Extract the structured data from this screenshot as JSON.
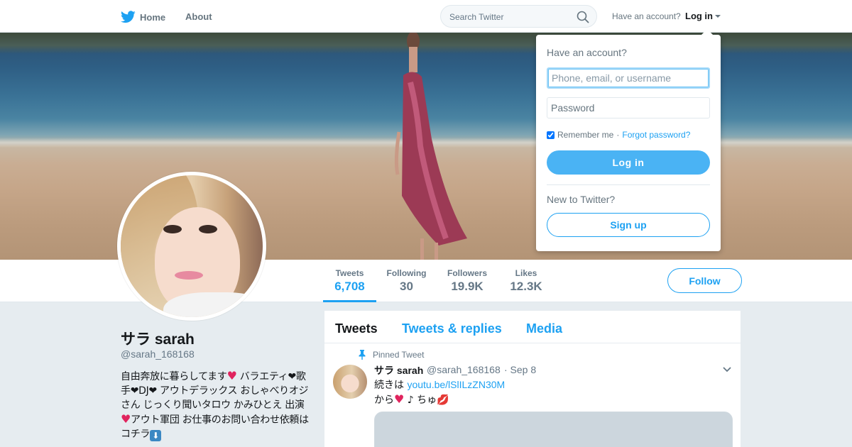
{
  "nav": {
    "home_label": "Home",
    "about_label": "About",
    "search_placeholder": "Search Twitter",
    "have_account": "Have an account?",
    "login_label": "Log in"
  },
  "profile": {
    "name": "サラ sarah",
    "handle": "@sarah_168168",
    "bio": {
      "part1": "自由奔放に暮らしてます",
      "part2": " バラエティ",
      "part3": "❤歌手❤DJ❤ アウトデラックス おしゃべりオジさん じっくり聞いタロウ かみひとえ 出演",
      "part4": "アウト軍団 お仕事のお問い合わせ依頼はコチラ",
      "heart": "♥",
      "arrow": "⬇"
    }
  },
  "stats": [
    {
      "label": "Tweets",
      "value": "6,708"
    },
    {
      "label": "Following",
      "value": "30"
    },
    {
      "label": "Followers",
      "value": "19.9K"
    },
    {
      "label": "Likes",
      "value": "12.3K"
    }
  ],
  "follow_label": "Follow",
  "timeline": {
    "tabs": [
      "Tweets",
      "Tweets & replies",
      "Media"
    ],
    "pinned_label": "Pinned Tweet",
    "tweet": {
      "name": "サラ sarah",
      "handle": "@sarah_168168",
      "date": "· Sep 8",
      "line1_prefix": "続きは ",
      "link": "youtu.be/lSlILzZN30M",
      "line2_prefix": "から",
      "line2_suffix": " ♪ ちゅ",
      "lips": "💋"
    }
  },
  "login_dropdown": {
    "title": "Have an account?",
    "username_placeholder": "Phone, email, or username",
    "password_placeholder": "Password",
    "remember_me": "Remember me",
    "separator": " · ",
    "forgot_password": "Forgot password?",
    "login_button": "Log in",
    "new_to_twitter": "New to Twitter?",
    "signup_button": "Sign up"
  },
  "colors": {
    "accent": "#1da1f2",
    "login_button": "#4ab3f4",
    "heart": "#e0245e"
  },
  "icons": [
    "twitter-bird-icon",
    "search-icon",
    "caret-down-icon",
    "pin-icon",
    "chevron-down-icon"
  ]
}
